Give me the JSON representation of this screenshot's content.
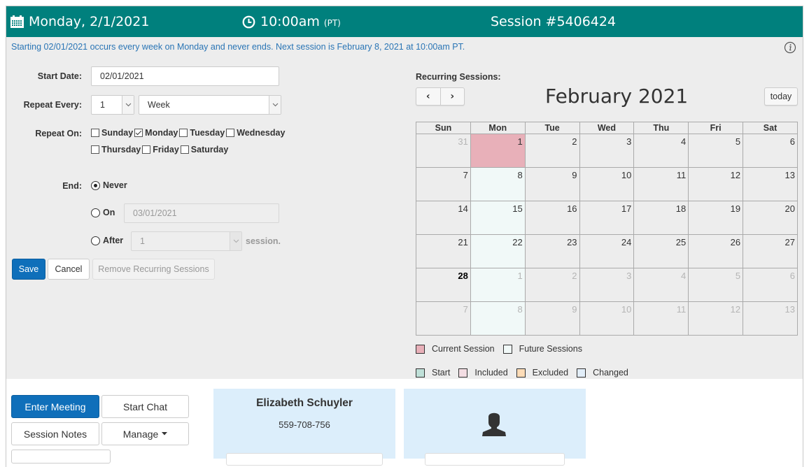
{
  "header": {
    "date": "Monday, 2/1/2021",
    "time": "10:00am",
    "timezone": "(PT)",
    "session": "Session #5406424",
    "icons": {
      "date": "calendar-icon",
      "time": "clock-icon"
    }
  },
  "colors": {
    "header_bg": "#00807d",
    "primary": "#0f6fba",
    "current_session": "#e8b0b9",
    "future_sessions": "#f1f9f8",
    "start": "#bfe0d8",
    "included": "#f3dde3",
    "excluded": "#fddcb7",
    "changed": "#e2eef9",
    "card_bg": "#dceefb"
  },
  "summary": "Starting 02/01/2021 occurs every week on Monday and never ends. Next session is February 8, 2021 at 10:00am PT.",
  "form": {
    "start_date_label": "Start Date:",
    "start_date_value": "02/01/2021",
    "repeat_every_label": "Repeat Every:",
    "repeat_every_count": "1",
    "repeat_every_unit": "Week",
    "repeat_on_label": "Repeat On:",
    "days": [
      {
        "label": "Sunday",
        "checked": false
      },
      {
        "label": "Monday",
        "checked": true
      },
      {
        "label": "Tuesday",
        "checked": false
      },
      {
        "label": "Wednesday",
        "checked": false
      },
      {
        "label": "Thursday",
        "checked": false
      },
      {
        "label": "Friday",
        "checked": false
      },
      {
        "label": "Saturday",
        "checked": false
      }
    ],
    "end_label": "End:",
    "end_options": {
      "never": {
        "label": "Never",
        "selected": true
      },
      "on": {
        "label": "On",
        "selected": false,
        "value": "03/01/2021"
      },
      "after": {
        "label": "After",
        "selected": false,
        "value": "1",
        "suffix": "session."
      }
    },
    "buttons": {
      "save": "Save",
      "cancel": "Cancel",
      "remove": "Remove Recurring Sessions"
    }
  },
  "calendar": {
    "label": "Recurring Sessions:",
    "month_title": "February 2021",
    "prev": "‹",
    "next": "›",
    "today": "today",
    "weekdays": [
      "Sun",
      "Mon",
      "Tue",
      "Wed",
      "Thu",
      "Fri",
      "Sat"
    ],
    "weeks": [
      [
        {
          "d": "31",
          "t": "other"
        },
        {
          "d": "1",
          "t": "current"
        },
        {
          "d": "2"
        },
        {
          "d": "3"
        },
        {
          "d": "4"
        },
        {
          "d": "5"
        },
        {
          "d": "6"
        }
      ],
      [
        {
          "d": "7"
        },
        {
          "d": "8",
          "t": "future"
        },
        {
          "d": "9"
        },
        {
          "d": "10"
        },
        {
          "d": "11"
        },
        {
          "d": "12"
        },
        {
          "d": "13"
        }
      ],
      [
        {
          "d": "14"
        },
        {
          "d": "15",
          "t": "future"
        },
        {
          "d": "16"
        },
        {
          "d": "17"
        },
        {
          "d": "18"
        },
        {
          "d": "19"
        },
        {
          "d": "20"
        }
      ],
      [
        {
          "d": "21"
        },
        {
          "d": "22",
          "t": "future"
        },
        {
          "d": "23"
        },
        {
          "d": "24"
        },
        {
          "d": "25"
        },
        {
          "d": "26"
        },
        {
          "d": "27"
        }
      ],
      [
        {
          "d": "28",
          "t": "today"
        },
        {
          "d": "1",
          "t": "other future"
        },
        {
          "d": "2",
          "t": "other"
        },
        {
          "d": "3",
          "t": "other"
        },
        {
          "d": "4",
          "t": "other"
        },
        {
          "d": "5",
          "t": "other"
        },
        {
          "d": "6",
          "t": "other"
        }
      ],
      [
        {
          "d": "7",
          "t": "other"
        },
        {
          "d": "8",
          "t": "other future"
        },
        {
          "d": "9",
          "t": "other"
        },
        {
          "d": "10",
          "t": "other"
        },
        {
          "d": "11",
          "t": "other"
        },
        {
          "d": "12",
          "t": "other"
        },
        {
          "d": "13",
          "t": "other"
        }
      ]
    ],
    "legend_row1": [
      {
        "label": "Current Session",
        "color": "#e8b0b9"
      },
      {
        "label": "Future Sessions",
        "color": "#f1f9f8"
      }
    ],
    "legend_row2": [
      {
        "label": "Start",
        "color": "#bfe0d8"
      },
      {
        "label": "Included",
        "color": "#f3dde3"
      },
      {
        "label": "Excluded",
        "color": "#fddcb7"
      },
      {
        "label": "Changed",
        "color": "#e2eef9"
      }
    ]
  },
  "actions": {
    "enter_meeting": "Enter Meeting",
    "start_chat": "Start Chat",
    "session_notes": "Session Notes",
    "manage": "Manage"
  },
  "contact": {
    "name": "Elizabeth Schuyler",
    "phone": "559-708-756"
  },
  "avatar_icon": "user-icon"
}
